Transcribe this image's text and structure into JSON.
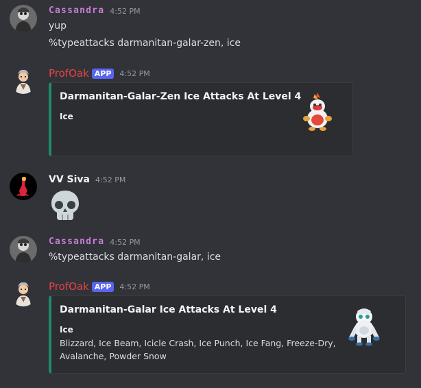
{
  "messages": [
    {
      "author": "Cassandra",
      "time": "4:52 PM",
      "lines": [
        "yup",
        "%typeattacks darmanitan-galar-zen, ice"
      ]
    },
    {
      "author": "ProfOak",
      "badge": "APP",
      "time": "4:52 PM",
      "embed": {
        "title": "Darmanitan-Galar-Zen Ice Attacks At Level 4",
        "field_name": "Ice",
        "field_value": "",
        "thumbnail_icon": "darmanitan-galar-zen-sprite"
      }
    },
    {
      "author": "VV Siva",
      "time": "4:52 PM",
      "emoji_icon": "skull-emoji"
    },
    {
      "author": "Cassandra",
      "time": "4:52 PM",
      "lines": [
        "%typeattacks darmanitan-galar, ice"
      ]
    },
    {
      "author": "ProfOak",
      "badge": "APP",
      "time": "4:52 PM",
      "embed": {
        "title": "Darmanitan-Galar Ice Attacks At Level 4",
        "field_name": "Ice",
        "field_value_lines": [
          "Blizzard, Ice Beam, Icicle Crash, Ice Punch, Ice Fang, Freeze-Dry,",
          "Avalanche, Powder Snow"
        ],
        "thumbnail_icon": "darmanitan-galar-sprite"
      }
    }
  ],
  "colors": {
    "background": "#313338",
    "embed_background": "#2b2d31",
    "embed_accent": "#1f8b6f",
    "cassandra_name": "#c77dd6",
    "profoak_name": "#ed4245",
    "app_badge": "#5865f2",
    "timestamp": "#949ba4"
  }
}
